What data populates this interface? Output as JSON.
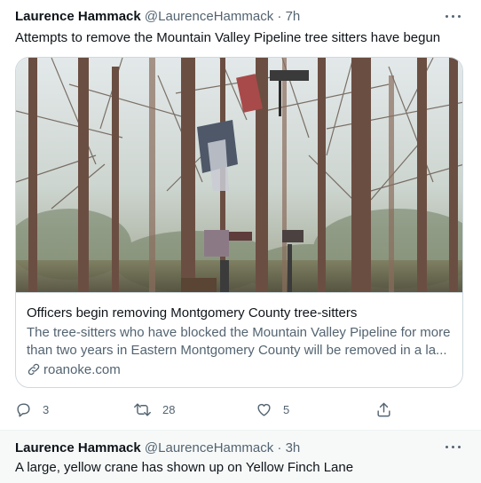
{
  "tweets": [
    {
      "name": "Laurence Hammack",
      "handle": "@LaurenceHammack",
      "time": "7h",
      "separator": "·",
      "text": "Attempts to remove the Mountain Valley Pipeline tree sitters have begun",
      "card": {
        "title": "Officers begin removing Montgomery County tree-sitters",
        "description_line1": "The tree-sitters who have blocked the Mountain Valley Pipeline for more",
        "description_line2": "than two years in Eastern Montgomery County will be removed in a la...",
        "domain": "roanoke.com",
        "image": "photo of tree-sitter platforms and tarps high in a winter forest canopy"
      },
      "actions": {
        "replies": "3",
        "retweets": "28",
        "likes": "5"
      }
    },
    {
      "name": "Laurence Hammack",
      "handle": "@LaurenceHammack",
      "time": "3h",
      "separator": "·",
      "text": "A large, yellow crane has shown up on Yellow Finch Lane"
    }
  ],
  "icons": {
    "more": "more-dots-icon",
    "reply": "reply-icon",
    "retweet": "retweet-icon",
    "like": "heart-icon",
    "share": "share-icon",
    "link": "link-icon"
  },
  "colors": {
    "text": "#0f1419",
    "secondary": "#536471",
    "border": "#cfd9de",
    "divider": "#eff3f4"
  }
}
